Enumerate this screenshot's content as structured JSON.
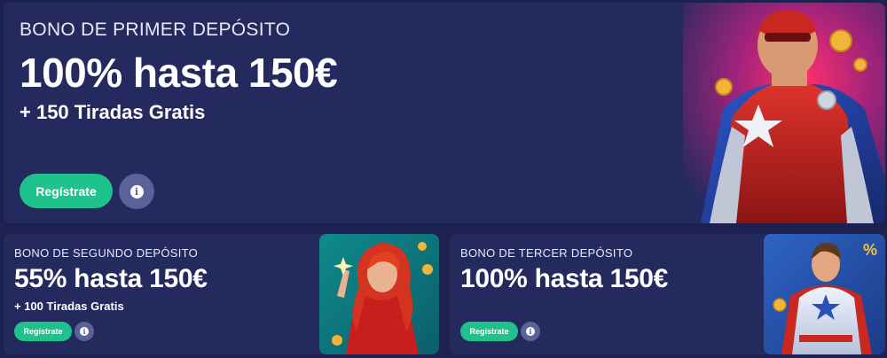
{
  "bonuses": [
    {
      "eyebrow": "BONO DE PRIMER DEPÓSITO",
      "headline": "100% hasta 150€",
      "subline": "+ 150 Tiradas Gratis",
      "register_label": "Regístrate",
      "info_glyph": "i",
      "art": "superhero-captain-illustration"
    },
    {
      "eyebrow": "BONO DE SEGUNDO DEPÓSITO",
      "headline": "55% hasta 150€",
      "subline": "+ 100 Tiradas Gratis",
      "register_label": "Regístrate",
      "info_glyph": "i",
      "art": "red-haired-heroine-illustration"
    },
    {
      "eyebrow": "BONO DE TERCER DEPÓSITO",
      "headline": "100% hasta 150€",
      "register_label": "Regístrate",
      "info_glyph": "i",
      "art": "superhero-with-percent-sign-illustration"
    }
  ],
  "percent_badge": "%",
  "colors": {
    "page_bg": "#1c2150",
    "card_bg": "#252a5e",
    "register_green": "#1fc28d",
    "info_bg": "#5b6199"
  }
}
